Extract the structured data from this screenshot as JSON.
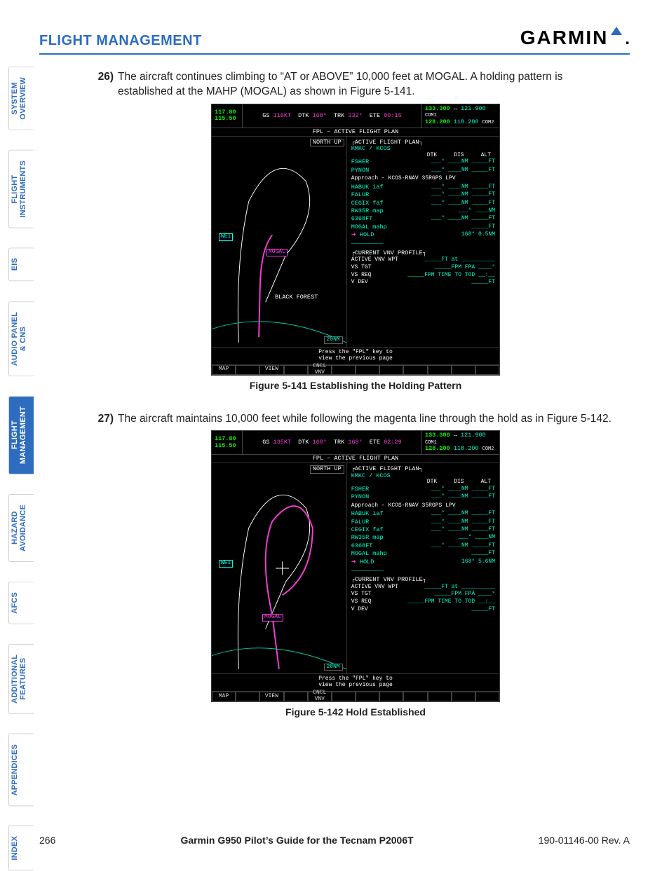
{
  "header": {
    "section": "FLIGHT MANAGEMENT",
    "brand": "GARMIN"
  },
  "tabs": [
    {
      "label": "SYSTEM\nOVERVIEW",
      "active": false
    },
    {
      "label": "FLIGHT\nINSTRUMENTS",
      "active": false
    },
    {
      "label": "EIS",
      "active": false
    },
    {
      "label": "AUDIO PANEL\n& CNS",
      "active": false
    },
    {
      "label": "FLIGHT\nMANAGEMENT",
      "active": true
    },
    {
      "label": "HAZARD\nAVOIDANCE",
      "active": false
    },
    {
      "label": "AFCS",
      "active": false
    },
    {
      "label": "ADDITIONAL\nFEATURES",
      "active": false
    },
    {
      "label": "APPENDICES",
      "active": false
    },
    {
      "label": "INDEX",
      "active": false
    }
  ],
  "items": [
    {
      "num": "26)",
      "text": "The aircraft continues climbing to “AT or ABOVE” 10,000 feet at MOGAL.  A holding pattern is established at the MAHP (MOGAL) as shown in Figure 5-141."
    },
    {
      "num": "27)",
      "text": "The aircraft maintains 10,000 feet while following  the magenta line through the hold as in Figure 5-142."
    }
  ],
  "captions": {
    "fig1": "Figure 5-141  Establishing the Holding Pattern",
    "fig2": "Figure 5-142  Hold Established"
  },
  "fig1": {
    "nav1_active": "117.80",
    "nav1_standby": "",
    "nav2_active": "115.50",
    "nav2_standby": "",
    "gs_label": "GS",
    "gs": "116KT",
    "dtk_label": "DTK",
    "dtk": "168°",
    "trk_label": "TRK",
    "trk": "332°",
    "ete_label": "ETE",
    "ete": "00:15",
    "com1_active": "133.300",
    "com1_standby": "121.900",
    "com1_lbl": "COM1",
    "com2_active": "128.200",
    "com2_standby": "118.200",
    "com2_lbl": "COM2",
    "page_title": "FPL – ACTIVE FLIGHT PLAN",
    "north_up": "NORTH UP",
    "map_wpt_mogal": "MOGAL",
    "map_wpt_wei": "WEI",
    "map_city": "BLACK FOREST",
    "scale": "20NM",
    "afp_hdr": "ACTIVE FLIGHT PLAN",
    "route": "KMKC / KCOS",
    "col_dtk": "DTK",
    "col_dis": "DIS",
    "col_alt": "ALT",
    "legs": [
      {
        "name": "FSHER",
        "dtk": "___°",
        "dis": "____NM",
        "alt": "_____FT"
      },
      {
        "name": "PYNON",
        "dtk": "___°",
        "dis": "____NM",
        "alt": "_____FT"
      }
    ],
    "approach": "Approach – KCOS-RNAV 35RGPS LPV",
    "legs2": [
      {
        "name": "HABUK iaf",
        "dtk": "___°",
        "dis": "____NM",
        "alt": "_____FT"
      },
      {
        "name": "FALUR",
        "dtk": "___°",
        "dis": "____NM",
        "alt": "_____FT"
      },
      {
        "name": "CEGIX faf",
        "dtk": "___°",
        "dis": "____NM",
        "alt": "_____FT"
      },
      {
        "name": "RW35R map",
        "dtk": "___°",
        "dis": "____NM",
        "alt": ""
      },
      {
        "name": "6368FT",
        "dtk": "___°",
        "dis": "____NM",
        "alt": "_____FT"
      },
      {
        "name": "MOGAL mahp",
        "dtk": "",
        "dis": "",
        "alt": "_____FT"
      },
      {
        "name": "HOLD",
        "dtk": "168°",
        "dis": "0.5NM",
        "alt": "",
        "arrow": true
      }
    ],
    "vnv_hdr": "CURRENT VNV PROFILE",
    "vnv": [
      {
        "l": "ACTIVE VNV WPT",
        "m": "_____FT at",
        "r": "__________"
      },
      {
        "l": "VS TGT",
        "m": "_____FPM",
        "r": "FPA   ____°"
      },
      {
        "l": "VS REQ",
        "m": "_____FPM",
        "r": "TIME TO TOD  __:__"
      },
      {
        "l": "V DEV",
        "m": "_____FT",
        "r": ""
      }
    ],
    "hint1": "Press the \"FPL\" key to",
    "hint2": "view the previous page",
    "softkeys": [
      "MAP",
      "",
      "VIEW",
      "",
      "CNCL VNV",
      "",
      "",
      "",
      "",
      "",
      "",
      ""
    ]
  },
  "fig2": {
    "nav1_active": "117.80",
    "nav2_active": "115.50",
    "gs_label": "GS",
    "gs": "135KT",
    "dtk_label": "DTK",
    "dtk": "168°",
    "trk_label": "TRK",
    "trk": "168°",
    "ete_label": "ETE",
    "ete": "02:29",
    "com1_active": "133.300",
    "com1_standby": "121.900",
    "com1_lbl": "COM1",
    "com2_active": "128.200",
    "com2_standby": "118.200",
    "com2_lbl": "COM2",
    "page_title": "FPL – ACTIVE FLIGHT PLAN",
    "north_up": "NORTH UP",
    "map_wpt_mogal": "MOGAL",
    "map_wpt_wei": "WEI",
    "scale": "20NM",
    "afp_hdr": "ACTIVE FLIGHT PLAN",
    "route": "KMKC / KCOS",
    "col_dtk": "DTK",
    "col_dis": "DIS",
    "col_alt": "ALT",
    "legs": [
      {
        "name": "FSHER",
        "dtk": "___°",
        "dis": "____NM",
        "alt": "_____FT"
      },
      {
        "name": "PYNON",
        "dtk": "___°",
        "dis": "____NM",
        "alt": "_____FT"
      }
    ],
    "approach": "Approach – KCOS-RNAV 35RGPS LPV",
    "legs2": [
      {
        "name": "HABUK iaf",
        "dtk": "___°",
        "dis": "____NM",
        "alt": "_____FT"
      },
      {
        "name": "FALUR",
        "dtk": "___°",
        "dis": "____NM",
        "alt": "_____FT"
      },
      {
        "name": "CEGIX faf",
        "dtk": "___°",
        "dis": "____NM",
        "alt": "_____FT"
      },
      {
        "name": "RW35R map",
        "dtk": "___°",
        "dis": "____NM",
        "alt": ""
      },
      {
        "name": "6368FT",
        "dtk": "___°",
        "dis": "____NM",
        "alt": "_____FT"
      },
      {
        "name": "MOGAL mahp",
        "dtk": "",
        "dis": "",
        "alt": "_____FT"
      },
      {
        "name": "HOLD",
        "dtk": "168°",
        "dis": "5.6NM",
        "alt": "",
        "arrow": true
      }
    ],
    "vnv_hdr": "CURRENT VNV PROFILE",
    "vnv": [
      {
        "l": "ACTIVE VNV WPT",
        "m": "_____FT at",
        "r": "__________"
      },
      {
        "l": "VS TGT",
        "m": "_____FPM",
        "r": "FPA   ____°"
      },
      {
        "l": "VS REQ",
        "m": "_____FPM",
        "r": "TIME TO TOD  __:__"
      },
      {
        "l": "V DEV",
        "m": "_____FT",
        "r": ""
      }
    ],
    "hint1": "Press the \"FPL\" key to",
    "hint2": "view the previous page",
    "softkeys": [
      "MAP",
      "",
      "VIEW",
      "",
      "CNCL VNV",
      "",
      "",
      "",
      "",
      "",
      "",
      ""
    ]
  },
  "footer": {
    "page": "266",
    "guide": "Garmin G950 Pilot’s Guide for the Tecnam P2006T",
    "rev": "190-01146-00  Rev. A"
  }
}
